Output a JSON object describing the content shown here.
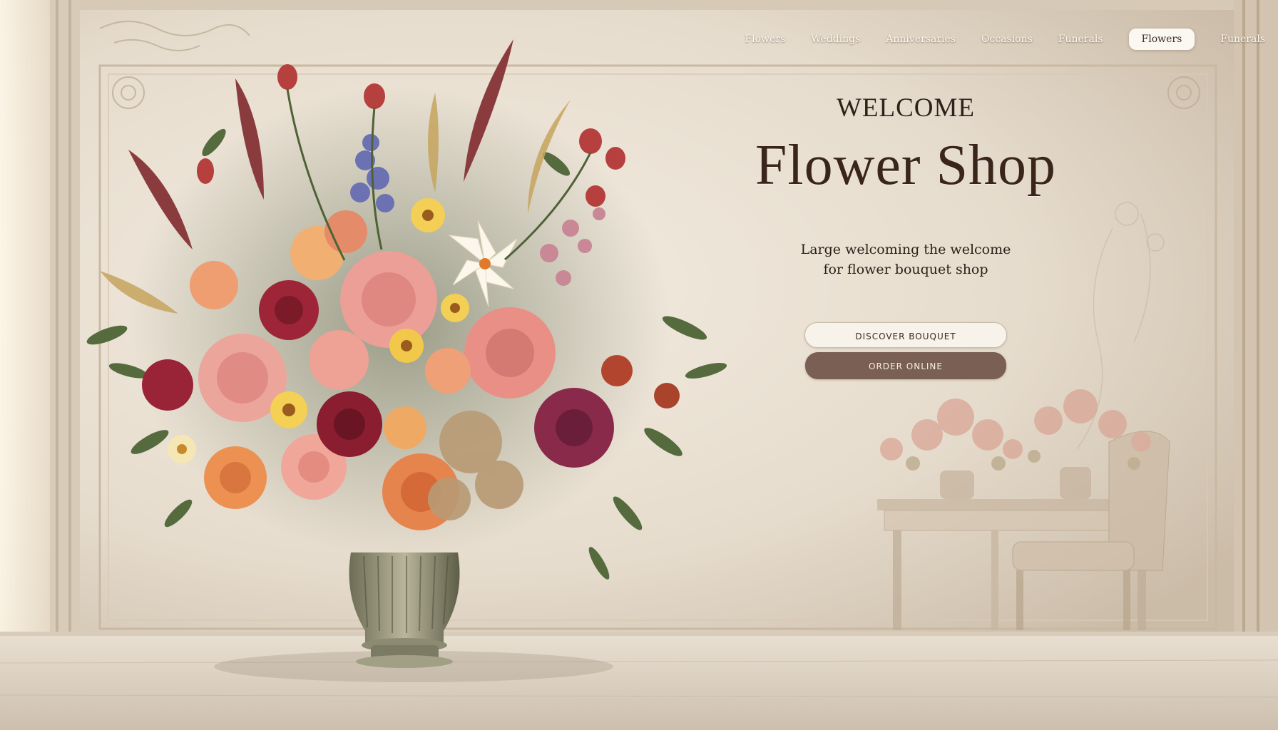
{
  "nav": {
    "items": [
      {
        "label": "Flowers"
      },
      {
        "label": "Weddings"
      },
      {
        "label": "Anniversaries"
      },
      {
        "label": "Occasions"
      },
      {
        "label": "Funerals"
      },
      {
        "label": "Flowers"
      },
      {
        "label": "Funerals"
      }
    ],
    "active_index": 5
  },
  "hero": {
    "welcome": "WELCOME",
    "title": "Flower Shop",
    "tagline_line1": "Large welcoming the welcome",
    "tagline_line2": "for flower bouquet shop",
    "primary_button": "DISCOVER BOUQUET",
    "secondary_button": "ORDER ONLINE"
  },
  "colors": {
    "wall": "#e9dfd1",
    "accent_button": "#7a5f54",
    "title_text": "#3a251c"
  }
}
